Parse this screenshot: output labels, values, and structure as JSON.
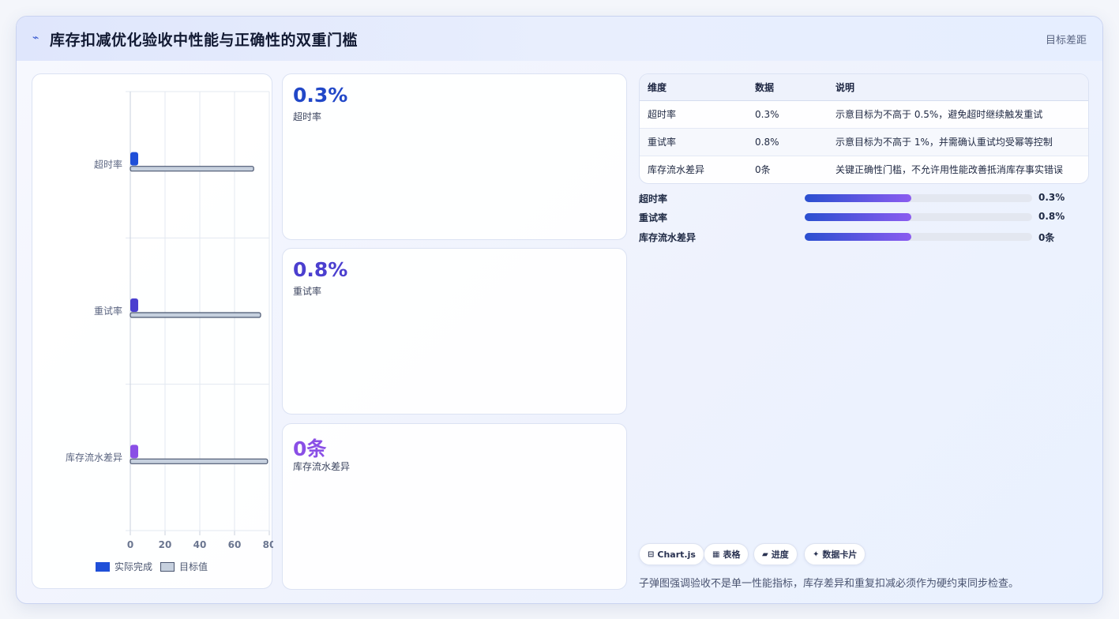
{
  "header": {
    "icon": "pulse-icon",
    "title": "库存扣减优化验收中性能与正确性的双重门槛",
    "right_label": "目标差距"
  },
  "colors": {
    "actual_bar": "#1f4fd8",
    "target_bar": "#c6d0de",
    "stat_value_1": "#2248c8",
    "stat_value_2": "#4b3fcf",
    "stat_value_3": "#8a4fe6"
  },
  "chart_data": {
    "type": "bar",
    "orientation": "horizontal",
    "categories": [
      "超时率",
      "重试率",
      "库存流水差异"
    ],
    "series": [
      {
        "name": "实际完成",
        "values": [
          0.3,
          0.8,
          0
        ],
        "color": "#1f4fd8"
      },
      {
        "name": "目标值",
        "values": [
          71,
          75,
          79
        ],
        "color": "#c6d0de"
      }
    ],
    "xlim": [
      0,
      80
    ],
    "xticks": [
      "0",
      "20",
      "40",
      "60",
      "80"
    ],
    "grid": true,
    "legend_position": "bottom"
  },
  "stats": [
    {
      "value": "0.3%",
      "label": "超时率"
    },
    {
      "value": "0.8%",
      "label": "重试率"
    },
    {
      "value": "0条",
      "label": "库存流水差异"
    }
  ],
  "table": {
    "headers": [
      "维度",
      "数据",
      "说明"
    ],
    "rows": [
      [
        "超时率",
        "0.3%",
        "示意目标为不高于 0.5%，避免超时继续触发重试"
      ],
      [
        "重试率",
        "0.8%",
        "示意目标为不高于 1%，并需确认重试均受幂等控制"
      ],
      [
        "库存流水差异",
        "0条",
        "关键正确性门槛，不允许用性能改善抵消库存事实错误"
      ]
    ]
  },
  "progress": [
    {
      "label": "超时率",
      "value": "0.3%",
      "fraction": 0.47
    },
    {
      "label": "重试率",
      "value": "0.8%",
      "fraction": 0.47
    },
    {
      "label": "库存流水差异",
      "value": "0条",
      "fraction": 0.47
    }
  ],
  "pills": [
    {
      "icon": "chart-icon",
      "glyph": "⊟",
      "label": "Chart.js"
    },
    {
      "icon": "table-icon",
      "glyph": "▦",
      "label": "表格"
    },
    {
      "icon": "progress-icon",
      "glyph": "▰",
      "label": "进度"
    },
    {
      "icon": "card-icon",
      "glyph": "✦",
      "label": "数据卡片"
    }
  ],
  "footnote": "子弹图强调验收不是单一性能指标，库存差异和重复扣减必须作为硬约束同步检查。"
}
